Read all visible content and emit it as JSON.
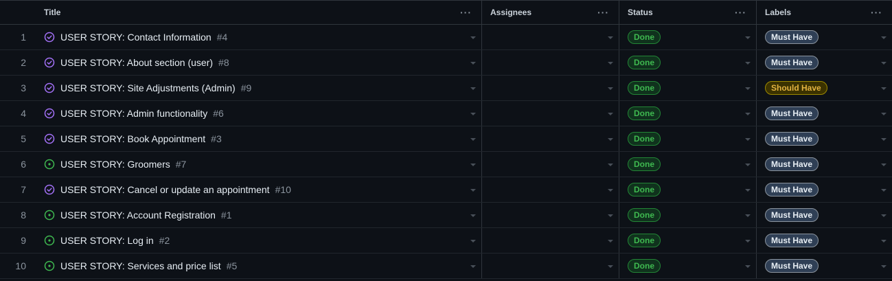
{
  "columns": {
    "title": "Title",
    "assignees": "Assignees",
    "status": "Status",
    "labels": "Labels"
  },
  "menu_glyph": "···",
  "rows": [
    {
      "n": "1",
      "title": "USER STORY: Contact Information",
      "issue": "#4",
      "state": "closed",
      "status": "Done",
      "label": "Must Have"
    },
    {
      "n": "2",
      "title": "USER STORY: About section (user)",
      "issue": "#8",
      "state": "closed",
      "status": "Done",
      "label": "Must Have"
    },
    {
      "n": "3",
      "title": "USER STORY: Site Adjustments (Admin)",
      "issue": "#9",
      "state": "closed",
      "status": "Done",
      "label": "Should Have"
    },
    {
      "n": "4",
      "title": "USER STORY: Admin functionality",
      "issue": "#6",
      "state": "closed",
      "status": "Done",
      "label": "Must Have"
    },
    {
      "n": "5",
      "title": "USER STORY: Book Appointment",
      "issue": "#3",
      "state": "closed",
      "status": "Done",
      "label": "Must Have"
    },
    {
      "n": "6",
      "title": "USER STORY: Groomers",
      "issue": "#7",
      "state": "open",
      "status": "Done",
      "label": "Must Have"
    },
    {
      "n": "7",
      "title": "USER STORY: Cancel or update an appointment",
      "issue": "#10",
      "state": "closed",
      "status": "Done",
      "label": "Must Have"
    },
    {
      "n": "8",
      "title": "USER STORY: Account Registration",
      "issue": "#1",
      "state": "open",
      "status": "Done",
      "label": "Must Have"
    },
    {
      "n": "9",
      "title": "USER STORY: Log in",
      "issue": "#2",
      "state": "open",
      "status": "Done",
      "label": "Must Have"
    },
    {
      "n": "10",
      "title": "USER STORY: Services and price list",
      "issue": "#5",
      "state": "open",
      "status": "Done",
      "label": "Must Have"
    }
  ],
  "colors": {
    "closed_icon": "#a371f7",
    "open_icon": "#3fb950"
  }
}
